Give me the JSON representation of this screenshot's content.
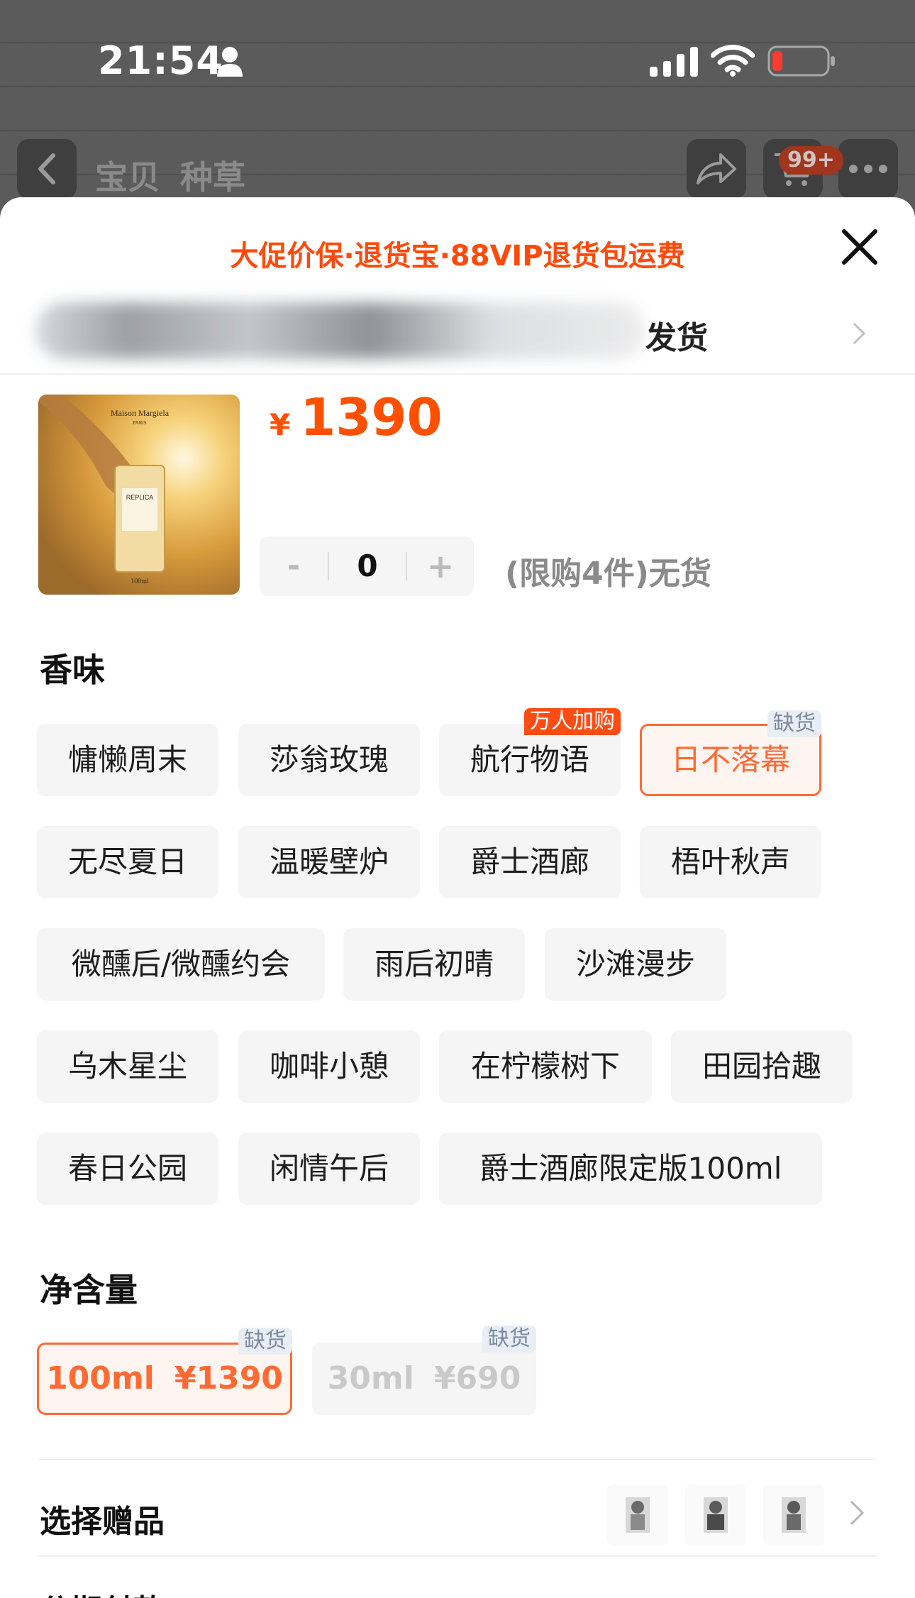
{
  "status_bar": {
    "time": "21:54"
  },
  "nav": {
    "tabs": [
      "宝贝",
      "种草"
    ],
    "cart_badge": "99+"
  },
  "sheet": {
    "promo": "大促价保·退货宝·88VIP退货包运费",
    "shipping_suffix": "发货",
    "price": {
      "currency": "¥",
      "value": "1390"
    },
    "stepper": {
      "minus": "-",
      "value": "0",
      "plus": "+"
    },
    "limit_text": "(限购4件)无货",
    "scent_title": "香味",
    "scents": [
      {
        "label": "慵懒周末"
      },
      {
        "label": "莎翁玫瑰"
      },
      {
        "label": "航行物语",
        "tag": "万人加购"
      },
      {
        "label": "日不落幕",
        "tag": "缺货",
        "selected": true
      },
      {
        "label": "无尽夏日"
      },
      {
        "label": "温暖壁炉"
      },
      {
        "label": "爵士酒廊"
      },
      {
        "label": "梧叶秋声"
      },
      {
        "label": "微醺后/微醺约会"
      },
      {
        "label": "雨后初晴"
      },
      {
        "label": "沙滩漫步"
      },
      {
        "label": "乌木星尘"
      },
      {
        "label": "咖啡小憩"
      },
      {
        "label": "在柠檬树下"
      },
      {
        "label": "田园拾趣"
      },
      {
        "label": "春日公园"
      },
      {
        "label": "闲情午后"
      },
      {
        "label": "爵士酒廊限定版100ml"
      }
    ],
    "size_title": "净含量",
    "sizes": [
      {
        "size": "100ml",
        "price": "¥1390",
        "tag": "缺货",
        "selected": true
      },
      {
        "size": "30ml",
        "price": "¥690",
        "tag": "缺货",
        "disabled": true
      }
    ],
    "gift_label": "选择赠品",
    "next_section_title": "分期付款"
  },
  "colors": {
    "accent": "#ff5000",
    "selected_border": "#ff6a33",
    "chip_bg": "#f5f5f5",
    "hot_tag": "#ff4c14",
    "oos_tag_bg": "#e9eef5"
  },
  "icons": [
    "person-icon",
    "signal-icon",
    "wifi-icon",
    "battery-icon",
    "back-icon",
    "share-icon",
    "cart-icon",
    "more-icon",
    "close-icon",
    "chevron-right-icon"
  ]
}
